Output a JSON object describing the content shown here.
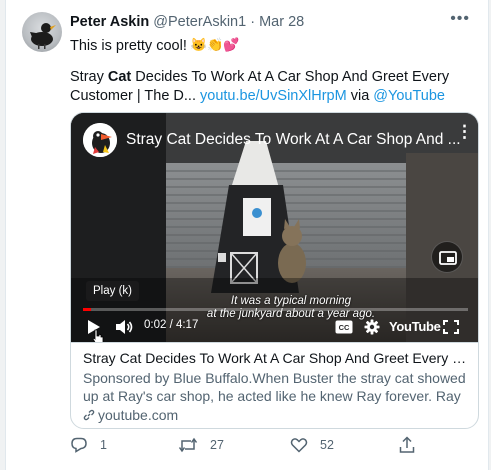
{
  "tweet": {
    "author_name": "Peter Askin",
    "author_handle": "@PeterAskin1",
    "separator": "·",
    "date": "Mar 28",
    "more_icon": "more-icon",
    "text_line1": "This is pretty cool!",
    "emojis": [
      "😺",
      "👏",
      "💕"
    ],
    "text_pre": "Stray ",
    "text_bold": "Cat",
    "text_post": " Decides To Work At A Car Shop And Greet Every Customer | The D...",
    "link_text": "youtu.be/UvSinXlHrpM",
    "via": "via",
    "mention": "@YouTube"
  },
  "video": {
    "title": "Stray Cat Decides To Work At A Car Shop And ...",
    "tooltip": "Play (k)",
    "caption_line1": "It was a typical morning",
    "caption_line2": "at the junkyard about a year ago.",
    "time": "0:02 / 4:17",
    "progress": 0.008,
    "youtube_wordmark": "YouTube"
  },
  "card": {
    "title": "Stray Cat Decides To Work At A Car Shop And Greet Every Custome...",
    "description": "Sponsored by Blue Buffalo.When Buster the stray cat showed up at Ray's car shop, he acted like he knew Ray forever. Ray had several ...",
    "domain": "youtube.com"
  },
  "actions": {
    "reply_count": "1",
    "retweet_count": "27",
    "like_count": "52"
  },
  "colors": {
    "link": "#1b95e0",
    "secondary_text": "#536471",
    "progress": "#ff0000"
  }
}
